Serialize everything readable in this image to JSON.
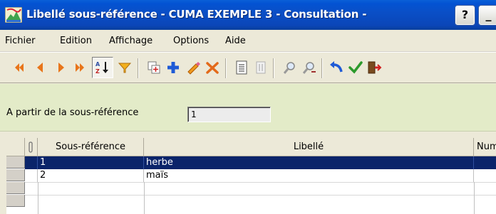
{
  "window": {
    "title": "Libellé sous-référence - CUMA EXEMPLE 3 - Consultation -",
    "help_button": "?",
    "minimize_button": "_"
  },
  "menu": {
    "items": [
      "Fichier",
      "Edition",
      "Affichage",
      "Options",
      "Aide"
    ]
  },
  "toolbar": {
    "icons": [
      "first-icon",
      "previous-icon",
      "next-icon",
      "last-icon",
      "sort-icon",
      "filter-icon",
      "duplicate-icon",
      "add-icon",
      "edit-icon",
      "delete-icon",
      "list-icon",
      "print-icon",
      "search-icon",
      "search-next-icon",
      "undo-icon",
      "validate-icon",
      "exit-icon"
    ]
  },
  "filter": {
    "label": "A partir de la sous-référence",
    "value": "1"
  },
  "grid": {
    "columns": [
      "Sous-référence",
      "Libellé",
      "Num"
    ],
    "rows": [
      {
        "sous_reference": "1",
        "libelle": "herbe"
      },
      {
        "sous_reference": "2",
        "libelle": "maïs"
      }
    ],
    "selected_row": 0
  },
  "colors": {
    "titlebar": "#0a4fc7",
    "filter_panel": "#e3ebc8",
    "selection": "#0a246a"
  }
}
